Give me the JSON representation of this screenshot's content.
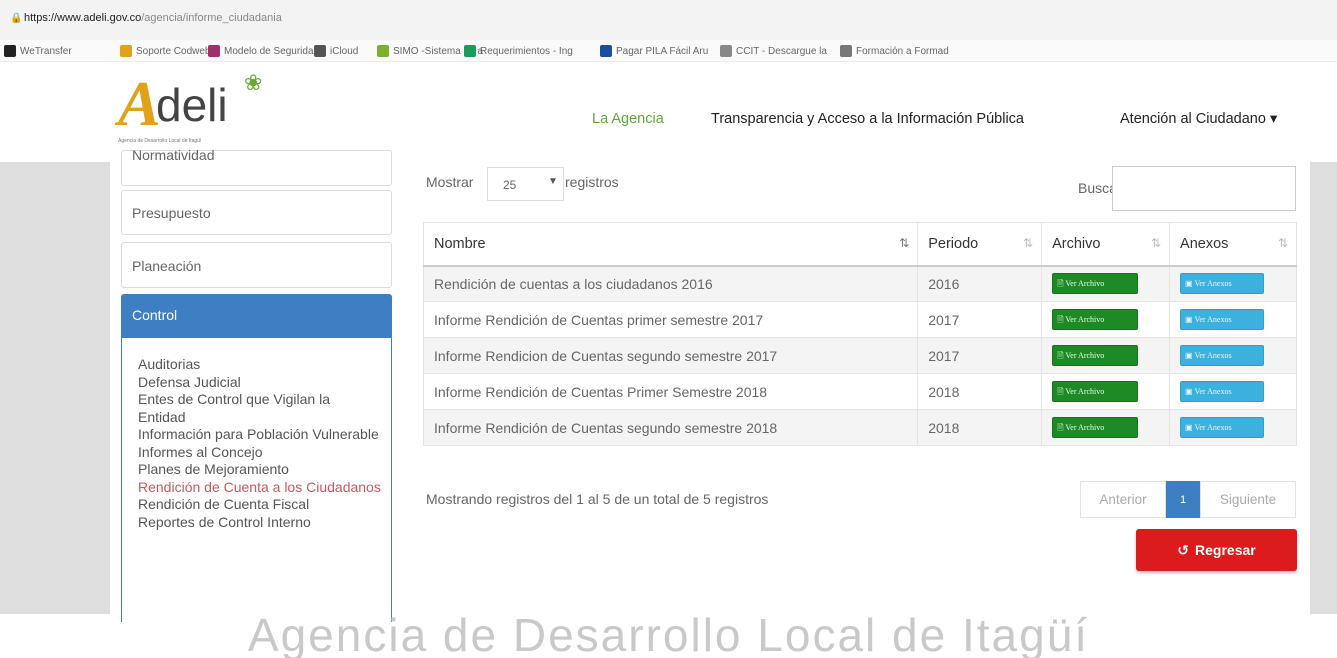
{
  "browser": {
    "url_domain": "https://www.adeli.gov.co",
    "url_path": "/agencia/informe_ciudadania",
    "bookmarks": [
      {
        "label": "WeTransfer",
        "color": "#222222"
      },
      {
        "label": "Soporte Codweb",
        "color": "#e0a21a"
      },
      {
        "label": "Modelo de Segurida",
        "color": "#a0306a"
      },
      {
        "label": "iCloud",
        "color": "#555555"
      },
      {
        "label": "SIMO -Sistema de a",
        "color": "#7ab02c"
      },
      {
        "label": "Requerimientos - Ing",
        "color": "#1e9a5a"
      },
      {
        "label": "Pagar PILA Fácil Aru",
        "color": "#1a4fa0"
      },
      {
        "label": "CCIT - Descargue la",
        "color": "#888888"
      },
      {
        "label": "Formación a Formad",
        "color": "#777777"
      }
    ]
  },
  "header": {
    "logo_letter": "A",
    "logo_text": "deli",
    "logo_tagline": "Agencia de Desarrollo Local de Itagüí",
    "nav": {
      "agencia": "La Agencia",
      "transparencia": "Transparencia y Acceso a la Información Pública",
      "atencion": "Atención al Ciudadano ▾"
    }
  },
  "sidebar": {
    "top_item": "Normatividad",
    "presupuesto": "Presupuesto",
    "planeacion": "Planeación",
    "control": "Control",
    "control_items": [
      "Auditorias",
      "Defensa Judicial",
      "Entes de Control que Vigilan la Entidad",
      "Información para Población Vulnerable",
      "Informes al Concejo",
      "Planes de Mejoramiento",
      "Rendición de Cuenta a los Ciudadanos",
      "Rendición de Cuenta Fiscal",
      "Reportes de Control Interno"
    ]
  },
  "table_controls": {
    "show_label": "Mostrar",
    "page_length": "25",
    "records_label": "registros",
    "search_label": "Buscar:"
  },
  "table": {
    "headers": [
      "Nombre",
      "Periodo",
      "Archivo",
      "Anexos"
    ],
    "rows": [
      {
        "nombre": "Rendición de cuentas a los ciudadanos 2016",
        "periodo": "2016"
      },
      {
        "nombre": "Informe Rendición de Cuentas primer semestre 2017",
        "periodo": "2017"
      },
      {
        "nombre": "Informe Rendicion de Cuentas segundo semestre 2017",
        "periodo": "2017"
      },
      {
        "nombre": "Informe Rendición de Cuentas Primer Semestre 2018",
        "periodo": "2018"
      },
      {
        "nombre": "Informe Rendición de Cuentas segundo semestre 2018",
        "periodo": "2018"
      }
    ],
    "archivo_button": "Ver Archivo",
    "anexos_button": "Ver Anexos"
  },
  "pagination": {
    "info": "Mostrando registros del 1 al 5 de un total de 5 registros",
    "previous": "Anterior",
    "current": "1",
    "next": "Siguiente"
  },
  "back_button": "Regresar",
  "footer_text": "Agencia de Desarrollo Local de Itagüí",
  "colors": {
    "brand_green": "#5cab36",
    "control_blue": "#3e7fc3",
    "archivo_green": "#1e8a25",
    "anexos_blue": "#3cb1dd",
    "regresar_red": "#dc1c1c"
  }
}
